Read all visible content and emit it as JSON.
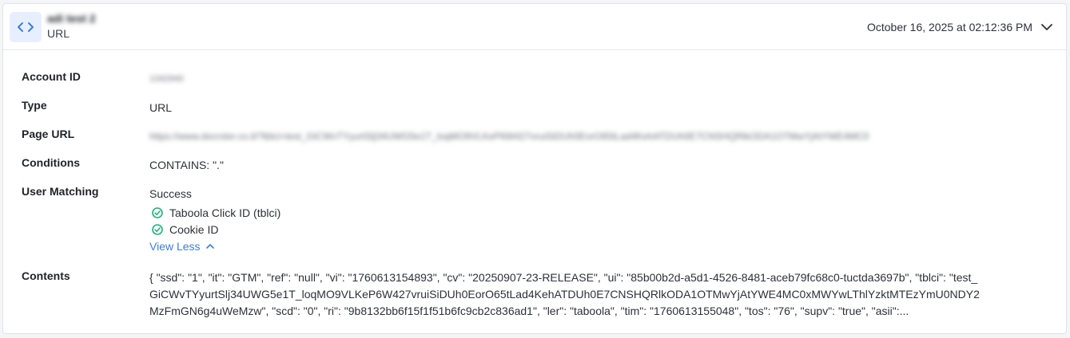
{
  "header": {
    "title": "adi test 2",
    "subtitle": "URL",
    "timestamp": "October 16, 2025 at 02:12:36 PM"
  },
  "fields": {
    "account_id": {
      "label": "Account ID",
      "value": "1342940"
    },
    "type": {
      "label": "Type",
      "value": "URL"
    },
    "page_url": {
      "label": "Page URL",
      "value": "https://www.docrster.co.il/?tblci=test_GiCWvTYyurtSlj34UWG5e1T_loqMO9VLKeP6W427vruiSiDUh0EorO65tLad4KehATDUh0E7CNSHQRlkODA1OTMwYjAtYWE4MC0"
    },
    "conditions": {
      "label": "Conditions",
      "value": "CONTAINS: \".\""
    },
    "user_matching": {
      "label": "User Matching",
      "status": "Success",
      "items": [
        "Taboola Click ID (tblci)",
        "Cookie ID"
      ],
      "toggle_label": "View Less"
    },
    "contents": {
      "label": "Contents",
      "value": "{ \"ssd\": \"1\", \"it\": \"GTM\", \"ref\": \"null\", \"vi\": \"1760613154893\", \"cv\": \"20250907-23-RELEASE\", \"ui\": \"85b00b2d-a5d1-4526-8481-aceb79fc68c0-tuctda3697b\", \"tblci\": \"test_GiCWvTYyurtSlj34UWG5e1T_loqMO9VLKeP6W427vruiSiDUh0EorO65tLad4KehATDUh0E7CNSHQRlkODA1OTMwYjAtYWE4MC0xMWYwLThlYzktMTEzYmU0NDY2MzFmGN6g4uWeMzw\", \"scd\": \"0\", \"ri\": \"9b8132bb6f15f1f51b6fc9cb2c836ad1\", \"ler\": \"taboola\", \"tim\": \"1760613155048\", \"tos\": \"76\", \"supv\": \"true\", \"asii\":..."
    }
  },
  "icons": {
    "code": "code-brackets-icon",
    "chevron": "chevron-down-icon",
    "check": "check-circle-icon",
    "chevron_up": "chevron-up-icon"
  },
  "colors": {
    "accent": "#3b7de0",
    "success": "#1fb37a",
    "badge_bg": "#e7efff"
  }
}
